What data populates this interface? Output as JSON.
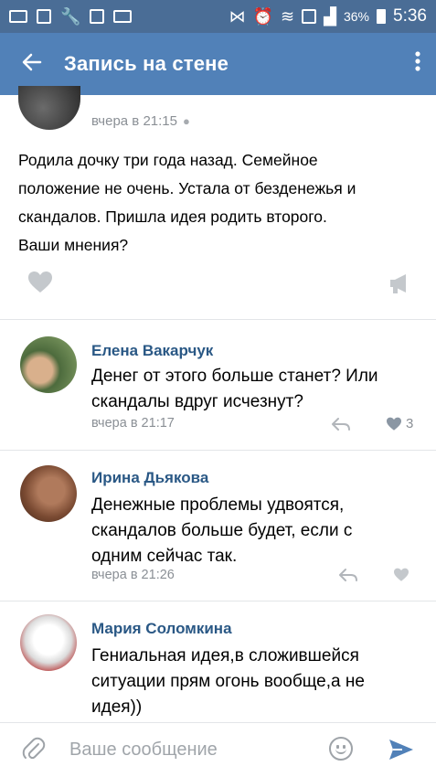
{
  "status_bar": {
    "battery_percent": "36%",
    "time": "5:36"
  },
  "app_bar": {
    "title": "Запись на стене",
    "back_icon": "arrow-left",
    "menu_icon": "more-vertical"
  },
  "post": {
    "time": "вчера в 21:15",
    "device_icon": "apple-icon",
    "text_lines": [
      "Родила дочку три года назад. Семейное",
      "положение не очень. Устала от безденежья и",
      "скандалов. Пришла идея родить второго.",
      "Ваши мнения?"
    ]
  },
  "comments": [
    {
      "author": "Елена Вакарчук",
      "text_lines": [
        "Денег от этого больше станет? Или",
        "скандалы вдруг исчезнут?"
      ],
      "time": "вчера в 21:17",
      "likes": "3"
    },
    {
      "author": "Ирина Дьякова",
      "text_lines": [
        "Денежные проблемы удвоятся,",
        "скандалов больше будет, если с",
        "одним сейчас так."
      ],
      "time": "вчера в 21:26"
    },
    {
      "author": "Мария Соломкина",
      "text_lines": [
        "Гениальная идея,в сложившейся",
        "ситуации прям огонь вообще,а не",
        "идея))"
      ]
    }
  ],
  "composer": {
    "placeholder": "Ваше сообщение"
  },
  "colors": {
    "status_bar": "#4a6d96",
    "app_bar": "#5181b8",
    "link": "#2a5885",
    "muted": "#8a8f95",
    "icon_gray": "#c4c8cc",
    "send": "#5181b8"
  }
}
